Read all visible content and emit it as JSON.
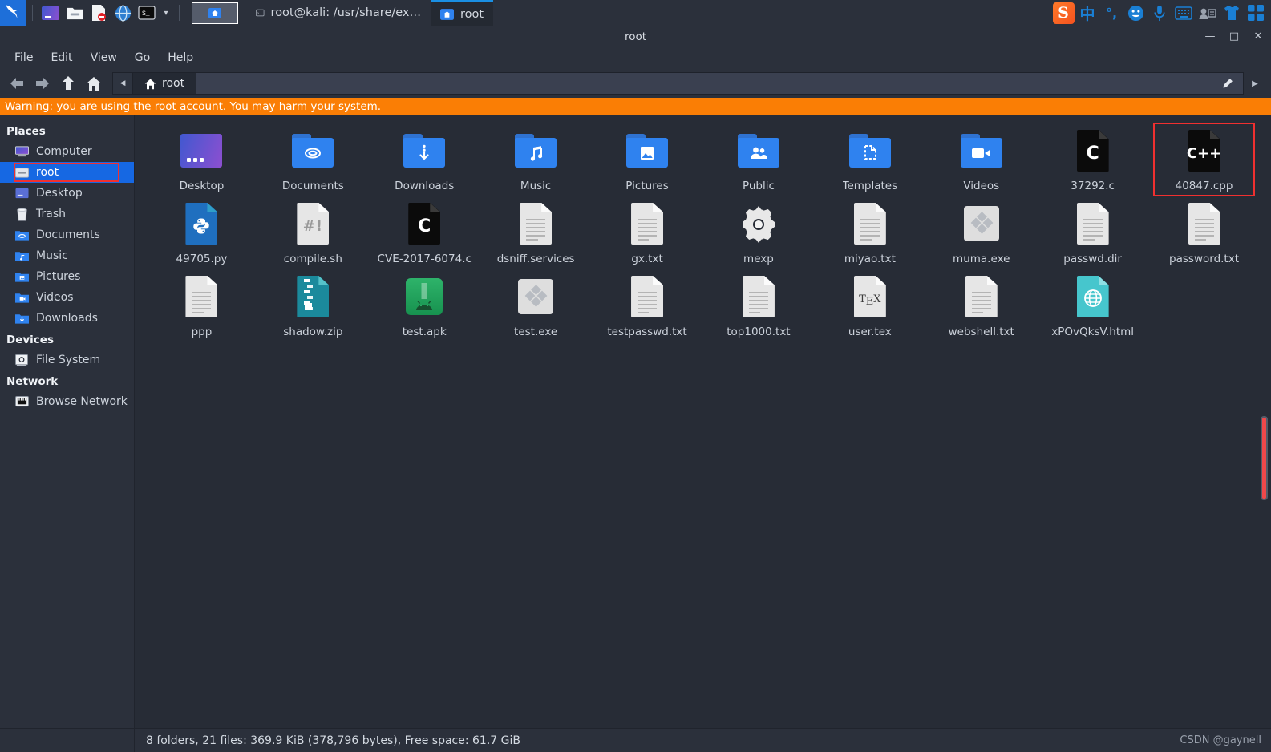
{
  "taskbar": {
    "kali_icon": "kali-dragon-icon",
    "launchers": [
      {
        "name": "display-settings-icon"
      },
      {
        "name": "file-manager-icon"
      },
      {
        "name": "text-editor-icon"
      },
      {
        "name": "web-browser-icon"
      },
      {
        "name": "terminal-icon"
      }
    ],
    "show_desktop_label": "",
    "tasks": [
      {
        "label": "root@kali: /usr/share/ex…",
        "icon": "terminal-icon",
        "active": false
      },
      {
        "label": "root",
        "icon": "folder-home-icon",
        "active": true
      }
    ],
    "tray": [
      {
        "name": "sogou-logo-icon",
        "glyph": "S"
      },
      {
        "name": "chinese-input-mode-icon",
        "glyph": "中"
      },
      {
        "name": "punctuation-mode-icon",
        "glyph": "°,"
      },
      {
        "name": "emoji-icon",
        "glyph": "☺"
      },
      {
        "name": "voice-input-icon",
        "glyph": "🎤"
      },
      {
        "name": "soft-keyboard-icon",
        "glyph": "⌨"
      },
      {
        "name": "user-card-icon",
        "glyph": "👤"
      },
      {
        "name": "skin-icon",
        "glyph": "👕"
      },
      {
        "name": "toolbox-icon",
        "glyph": "▦"
      }
    ]
  },
  "window": {
    "title": "root",
    "controls": {
      "minimize": "—",
      "maximize": "□",
      "close": "✕"
    },
    "menus": [
      "File",
      "Edit",
      "View",
      "Go",
      "Help"
    ],
    "toolbar": {
      "back": "back-icon",
      "forward": "forward-icon",
      "up": "up-icon",
      "home": "home-icon",
      "scroll_left": "◀",
      "breadcrumb": "root",
      "edit_path": "pencil-icon",
      "expand": "▶"
    },
    "warning": "Warning: you are using the root account. You may harm your system."
  },
  "sidebar": {
    "groups": [
      {
        "header": "Places",
        "items": [
          {
            "label": "Computer",
            "icon": "computer-icon",
            "selected": false
          },
          {
            "label": "root",
            "icon": "home-folder-icon",
            "selected": true
          },
          {
            "label": "Desktop",
            "icon": "desktop-icon",
            "selected": false
          },
          {
            "label": "Trash",
            "icon": "trash-icon",
            "selected": false
          },
          {
            "label": "Documents",
            "icon": "documents-folder-icon",
            "selected": false
          },
          {
            "label": "Music",
            "icon": "music-folder-icon",
            "selected": false
          },
          {
            "label": "Pictures",
            "icon": "pictures-folder-icon",
            "selected": false
          },
          {
            "label": "Videos",
            "icon": "videos-folder-icon",
            "selected": false
          },
          {
            "label": "Downloads",
            "icon": "downloads-folder-icon",
            "selected": false
          }
        ]
      },
      {
        "header": "Devices",
        "items": [
          {
            "label": "File System",
            "icon": "hard-disk-icon",
            "selected": false
          }
        ]
      },
      {
        "header": "Network",
        "items": [
          {
            "label": "Browse Network",
            "icon": "network-icon",
            "selected": false
          }
        ]
      }
    ]
  },
  "files": [
    {
      "name": "Desktop",
      "type": "desktop-image",
      "highlight": false
    },
    {
      "name": "Documents",
      "type": "folder-clip",
      "highlight": false
    },
    {
      "name": "Downloads",
      "type": "folder-down",
      "highlight": false
    },
    {
      "name": "Music",
      "type": "folder-music",
      "highlight": false
    },
    {
      "name": "Pictures",
      "type": "folder-picture",
      "highlight": false
    },
    {
      "name": "Public",
      "type": "folder-people",
      "highlight": false
    },
    {
      "name": "Templates",
      "type": "folder-template",
      "highlight": false
    },
    {
      "name": "Videos",
      "type": "folder-video",
      "highlight": false
    },
    {
      "name": "37292.c",
      "type": "c-file",
      "highlight": false,
      "glyph": "C"
    },
    {
      "name": "40847.cpp",
      "type": "cpp-file",
      "highlight": true,
      "glyph": "C++"
    },
    {
      "name": "49705.py",
      "type": "py-file",
      "highlight": false
    },
    {
      "name": "compile.sh",
      "type": "sh-file",
      "highlight": false,
      "glyph": "#!"
    },
    {
      "name": "CVE-2017-6074.c",
      "type": "c-file",
      "highlight": false,
      "glyph": "C"
    },
    {
      "name": "dsniff.services",
      "type": "text-file",
      "highlight": false
    },
    {
      "name": "gx.txt",
      "type": "text-file",
      "highlight": false
    },
    {
      "name": "mexp",
      "type": "executable-gear",
      "highlight": false
    },
    {
      "name": "miyao.txt",
      "type": "text-file",
      "highlight": false
    },
    {
      "name": "muma.exe",
      "type": "exe-file",
      "highlight": false
    },
    {
      "name": "passwd.dir",
      "type": "text-file",
      "highlight": false
    },
    {
      "name": "password.txt",
      "type": "text-file",
      "highlight": false
    },
    {
      "name": "ppp",
      "type": "text-file",
      "highlight": false
    },
    {
      "name": "shadow.zip",
      "type": "zip-file",
      "highlight": false
    },
    {
      "name": "test.apk",
      "type": "apk-file",
      "highlight": false
    },
    {
      "name": "test.exe",
      "type": "exe-file",
      "highlight": false
    },
    {
      "name": "testpasswd.txt",
      "type": "text-file",
      "highlight": false
    },
    {
      "name": "top1000.txt",
      "type": "text-file",
      "highlight": false
    },
    {
      "name": "user.tex",
      "type": "tex-file",
      "highlight": false,
      "glyph": "TeX"
    },
    {
      "name": "webshell.txt",
      "type": "text-file",
      "highlight": false
    },
    {
      "name": "xPOvQksV.html",
      "type": "html-file",
      "highlight": false
    }
  ],
  "statusbar": {
    "text": "8 folders, 21 files: 369.9 KiB (378,796 bytes), Free space: 61.7 GiB",
    "watermark": "CSDN @gaynell"
  },
  "colors": {
    "accent_blue": "#1668e3",
    "warning_orange": "#fa7e05",
    "highlight_red": "#f03030",
    "window_bg": "#2b303b",
    "file_area_bg": "#272c36"
  }
}
